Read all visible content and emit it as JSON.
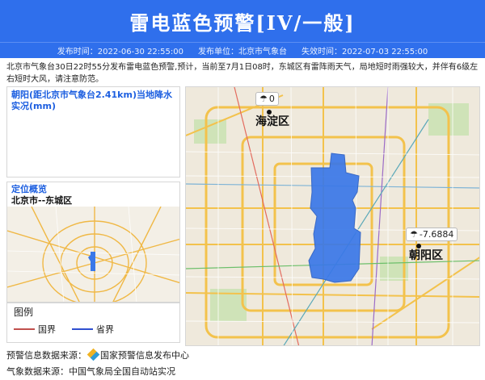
{
  "header": {
    "title": "雷电蓝色预警[IV/一般]",
    "accent": "#2f6fec"
  },
  "meta": {
    "publish_time": "发布时间：2022-06-30 22:55:00",
    "publisher": "发布单位：北京市气象台",
    "expire_time": "失效时间：2022-07-03 22:55:00"
  },
  "description": "北京市气象台30日22时55分发布雷电蓝色预警,预计，当前至7月1日08时，东城区有雷阵雨天气，局地短时雨强较大，并伴有6级左右短时大风，请注意防范。",
  "panel": {
    "rain_title": "朝阳(距北京市气象台2.41km)当地降水实况(mm)",
    "location_title": "定位概览",
    "location_value": "北京市--东城区",
    "legend_title": "图例",
    "legend_items": [
      {
        "label": "国界",
        "color": "#c0504d"
      },
      {
        "label": "省界",
        "color": "#2f4fd0"
      }
    ]
  },
  "map": {
    "stations": [
      {
        "value": "0",
        "icon": "rain-cloud-icon",
        "district": "海淀区"
      },
      {
        "value": "-7.6884",
        "icon": "rain-cloud-icon",
        "district": "朝阳区"
      }
    ],
    "highlight_color": "#3a78e8"
  },
  "footer": {
    "source1_label": "预警信息数据来源：",
    "source1_value": "国家预警信息发布中心",
    "source2": "气象数据来源：中国气象局全国自动站实况"
  }
}
